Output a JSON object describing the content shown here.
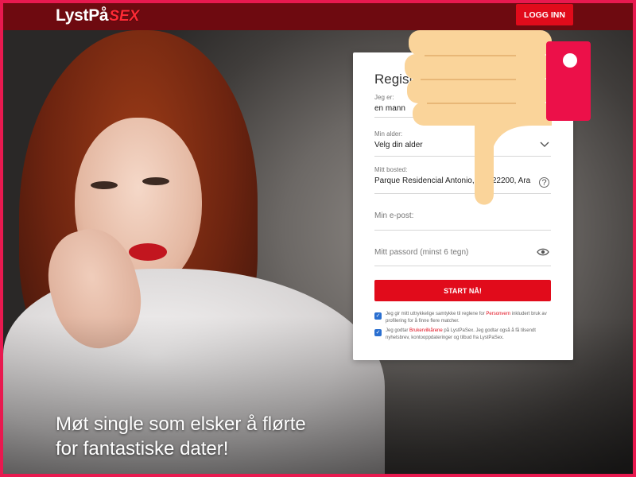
{
  "header": {
    "logo_main": "LystPå",
    "logo_accent": "SEX",
    "login_label": "LOGG INN"
  },
  "hero": {
    "tagline_line1": "Møt single som elsker å flørte",
    "tagline_line2": "for fantastiske dater!"
  },
  "form": {
    "title": "Registrer",
    "gender_label": "Jeg er:",
    "gender_value": "en mann",
    "age_label": "Min alder:",
    "age_value": "Velg din alder",
    "location_label": "Mitt bosted:",
    "location_value": "Parque Residencial Antonio, ...n, 22200, Ara",
    "email_placeholder": "Min e-post:",
    "password_placeholder": "Mitt passord (minst 6 tegn)",
    "start_label": "START NÅ!",
    "consent1_text": "Jeg gir mitt uttrykkelige samtykke til reglene for",
    "consent1_link": "Personvern",
    "consent1_rest": "inkludert bruk av profilering for å finne flere matcher.",
    "consent2_pre": "Jeg godtar",
    "consent2_link": "Brukervilkårene",
    "consent2_rest": "på LystPaSex. Jeg godtar også å få tilsendt nyhetsbrev, kontooppdateringer og tilbud fra LystPaSex."
  },
  "colors": {
    "brand_red": "#e10b1b",
    "header_bg": "#6e0a10",
    "frame_pink": "#e8194f",
    "thumb_skin": "#fad49a",
    "thumb_cuff": "#ec1049"
  },
  "icons": {
    "dropdown": "chevron-down-icon",
    "help": "question-circle-icon",
    "show_password": "eye-icon",
    "overlay": "thumbs-down-icon"
  }
}
